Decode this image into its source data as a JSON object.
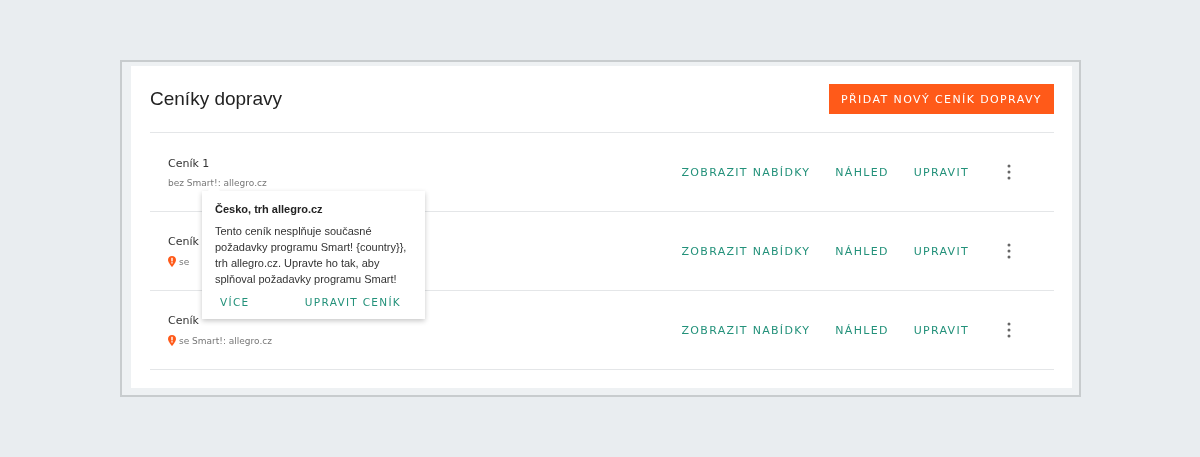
{
  "title": "Ceníky dopravy",
  "add_button": "PŘIDAT NOVÝ CENÍK DOPRAVY",
  "rows": [
    {
      "name": "Ceník 1",
      "subtitle": "bez Smart!: allegro.cz",
      "warning": false,
      "actions": [
        "ZOBRAZIT NABÍDKY",
        "NÁHLED",
        "UPRAVIT"
      ]
    },
    {
      "name": "Ceník",
      "subtitle": "se",
      "warning": true,
      "actions": [
        "ZOBRAZIT NABÍDKY",
        "NÁHLED",
        "UPRAVIT"
      ]
    },
    {
      "name": "Ceník",
      "subtitle": "se Smart!: allegro.cz",
      "warning": true,
      "actions": [
        "ZOBRAZIT NABÍDKY",
        "NÁHLED",
        "UPRAVIT"
      ]
    }
  ],
  "popover": {
    "title": "Česko, trh allegro.cz",
    "text": "Tento ceník nesplňuje současné požadavky programu Smart! {country}}, trh allegro.cz. Upravte ho tak, aby splňoval požadavky programu Smart!",
    "actions": [
      "VÍCE",
      "UPRAVIT CENÍK"
    ]
  }
}
